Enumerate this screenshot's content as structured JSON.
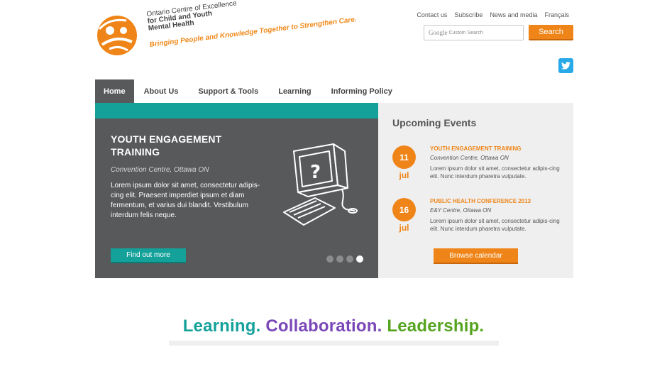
{
  "logo": {
    "line1": "Ontario Centre of Excellence",
    "line2": "for Child and Youth",
    "line3": "Mental Health",
    "tagline": "Bringing People and Knowledge Together to Strengthen Care."
  },
  "utility_links": [
    "Contact us",
    "Subscribe",
    "News and media",
    "Français"
  ],
  "search": {
    "google_label": "Google",
    "placeholder": "Custom Search",
    "button_label": "Search"
  },
  "nav": {
    "items": [
      {
        "label": "Home",
        "active": true
      },
      {
        "label": "About Us"
      },
      {
        "label": "Support & Tools"
      },
      {
        "label": "Learning"
      },
      {
        "label": "Informing Policy"
      }
    ]
  },
  "hero": {
    "title": "YOUTH ENGAGEMENT TRAINING",
    "location": "Convention Centre, Ottawa ON",
    "description": "Lorem ipsum dolor sit amet, consectetur adipis-cing elit. Praesent imperdiet ipsum et diam fermentum, et varius dui blandit. Vestibulum interdum felis neque.",
    "button_label": "Find out more",
    "slides": 4,
    "active_slide": 4
  },
  "events": {
    "title": "Upcoming Events",
    "items": [
      {
        "day": "11",
        "month": "jul",
        "title": "YOUTH ENGAGEMENT TRAINING",
        "location": "Convention Centre, Ottawa ON",
        "description": "Lorem ipsum dolor sit amet, consectetur adipis-cing elit. Nunc interdum pharetra vulputate."
      },
      {
        "day": "16",
        "month": "jul",
        "title": "PUBLIC HEALTH CONFERENCE 2013",
        "location": "E&Y Centre, Ottawa ON",
        "description": "Lorem ipsum dolor sit amet, consectetur adipis-cing elit. Nunc interdum pharetra vulputate."
      }
    ],
    "button_label": "Browse calendar"
  },
  "motto": {
    "part1": "Learning.",
    "part2": "Collaboration.",
    "part3": "Leadership."
  },
  "colors": {
    "orange": "#ef8518",
    "teal": "#14a19a",
    "dark_gray": "#58595b",
    "purple": "#7a47b8",
    "green": "#55a41f",
    "twitter_blue": "#29a9e8"
  }
}
